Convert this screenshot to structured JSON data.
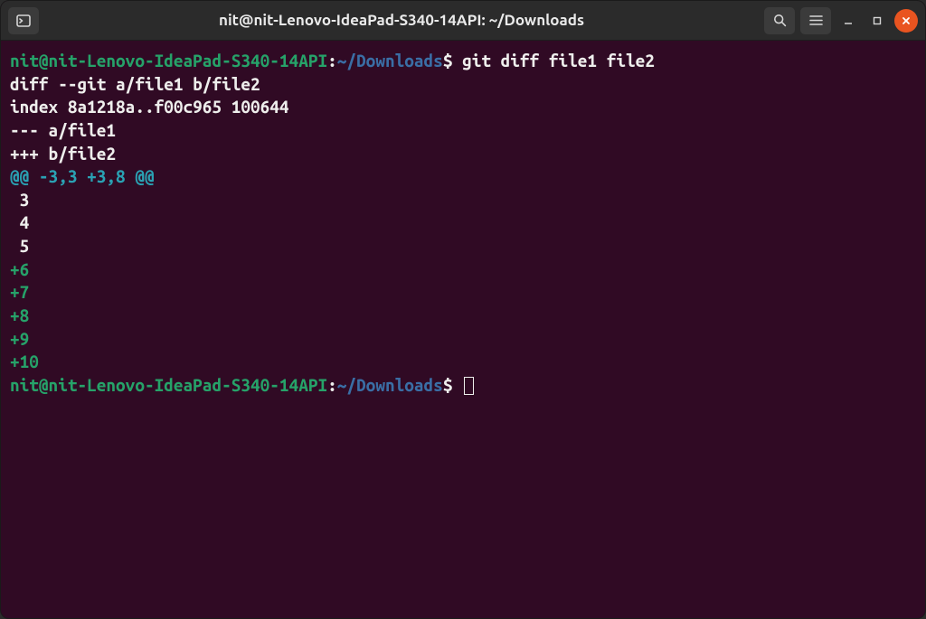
{
  "titlebar": {
    "title": "nit@nit-Lenovo-IdeaPad-S340-14API: ~/Downloads"
  },
  "prompt": {
    "user_host": "nit@nit-Lenovo-IdeaPad-S340-14API",
    "colon": ":",
    "path": "~/Downloads",
    "dollar": "$"
  },
  "command": "git diff file1 file2",
  "output": {
    "diff_header": "diff --git a/file1 b/file2",
    "index_line": "index 8a1218a..f00c965 100644",
    "minus_file": "--- a/file1",
    "plus_file": "+++ b/file2",
    "hunk": "@@ -3,3 +3,8 @@",
    "ctx1": " 3",
    "ctx2": " 4",
    "ctx3": " 5",
    "add1": "+6",
    "add2": "+7",
    "add3": "+8",
    "add4": "+9",
    "add5": "+10"
  }
}
